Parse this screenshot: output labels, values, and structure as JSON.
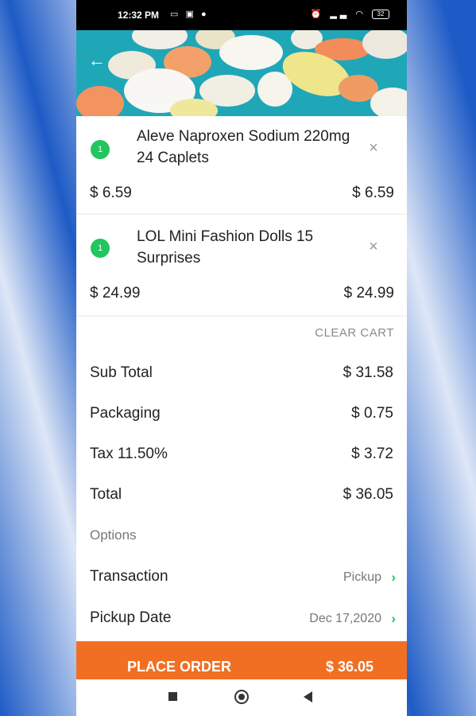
{
  "status_bar": {
    "time": "12:32 PM",
    "left_icons": [
      "laptop-icon",
      "app-icon",
      "messenger-icon"
    ],
    "right_icons": [
      "alarm-icon",
      "signal-icon",
      "wifi-icon",
      "battery-icon"
    ],
    "battery_level": "32"
  },
  "cart": {
    "items": [
      {
        "qty": "1",
        "name": "Aleve Naproxen Sodium 220mg 24 Caplets",
        "unit_price": "$ 6.59",
        "total_price": "$ 6.59",
        "remove_icon": "close-icon"
      },
      {
        "qty": "1",
        "name": "LOL Mini Fashion Dolls 15 Surprises",
        "unit_price": "$ 24.99",
        "total_price": "$ 24.99",
        "remove_icon": "close-icon"
      }
    ],
    "clear_label": "CLEAR CART"
  },
  "summary": {
    "subtotal_label": "Sub Total",
    "subtotal_value": "$ 31.58",
    "packaging_label": "Packaging",
    "packaging_value": "$ 0.75",
    "tax_label": "Tax 11.50%",
    "tax_value": "$ 3.72",
    "total_label": "Total",
    "total_value": "$ 36.05"
  },
  "options": {
    "heading": "Options",
    "transaction_label": "Transaction",
    "transaction_value": "Pickup",
    "pickup_date_label": "Pickup Date",
    "pickup_date_value": "Dec 17,2020"
  },
  "order_button": {
    "label": "PLACE ORDER",
    "amount": "$ 36.05"
  },
  "colors": {
    "accent_green": "#22c55e",
    "order_orange": "#f16f23",
    "hero_teal": "#1fa7b8"
  }
}
